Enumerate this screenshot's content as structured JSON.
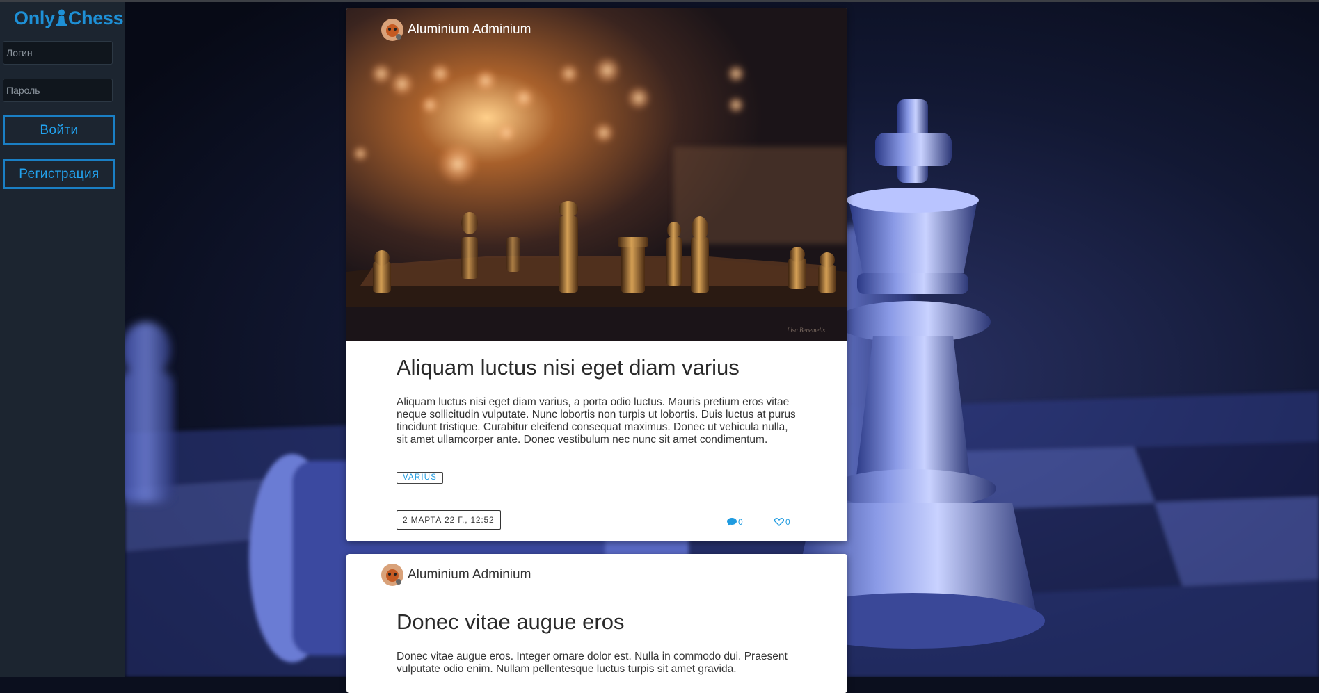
{
  "app": {
    "logo_left": "Only",
    "logo_right": "Chess"
  },
  "sidebar": {
    "login_placeholder": "Логин",
    "password_placeholder": "Пароль",
    "login_button": "Войти",
    "register_button": "Регистрация"
  },
  "posts": [
    {
      "author": "Aluminium Adminium",
      "title": "Aliquam luctus nisi eget diam varius",
      "text": "Aliquam luctus nisi eget diam varius, a porta odio luctus. Mauris pretium eros vitae neque sollicitudin vulputate. Nunc lobortis non turpis ut lobortis. Duis luctus at purus tincidunt tristique. Curabitur eleifend consequat maximus. Donec ut vehicula nulla, sit amet ullamcorper ante. Donec vestibulum nec nunc sit amet condimentum.",
      "tag": "VARIUS",
      "date": "2 МАРТА 22 Г., 12:52",
      "comments": "0",
      "likes": "0",
      "image_credit": "Lisa Benemelis"
    },
    {
      "author": "Aluminium Adminium",
      "title": "Donec vitae augue eros",
      "text": "Donec vitae augue eros. Integer ornare dolor est. Nulla in commodo dui. Praesent vulputate odio enim. Nullam pellentesque luctus turpis sit amet gravida."
    }
  ],
  "colors": {
    "accent": "#1f9be0",
    "sidebar": "#1c2530"
  }
}
